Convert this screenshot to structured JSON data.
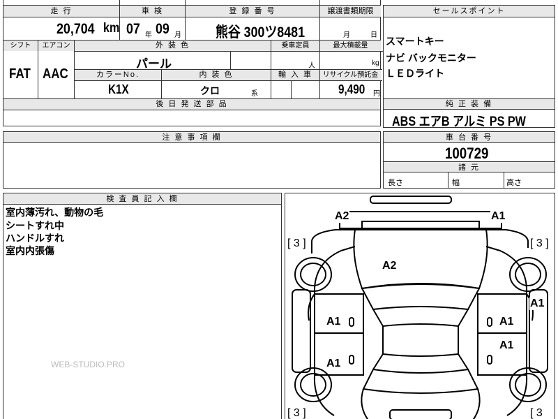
{
  "top_row": {
    "mileage_label": "走 行",
    "inspection_label": "車 検",
    "registration_label": "登 録 番 号",
    "transfer_label": "譲渡書類期限",
    "mileage_value": "20,704",
    "mileage_unit": "km",
    "inspection_year": "07",
    "year_unit": "年",
    "inspection_month": "09",
    "month_unit": "月",
    "registration_value": "熊谷 300ツ8481",
    "transfer_month_unit": "月",
    "transfer_day_unit": "日"
  },
  "spec_row": {
    "shift_label": "シフト",
    "ac_label": "エアコン",
    "exterior_label": "外 装 色",
    "capacity_label": "乗車定員",
    "load_label": "最大積載量",
    "shift_value": "FAT",
    "ac_value": "AAC",
    "exterior_value": "パール",
    "capacity_unit": "人",
    "load_unit": "kg",
    "color_no_label": "カラーNo.",
    "interior_label": "内 装 色",
    "import_label": "輸 入 車",
    "recycle_label": "リサイクル預託金",
    "color_no_value": "K1X",
    "interior_value": "クロ",
    "interior_suffix": "系",
    "recycle_value": "9,490",
    "recycle_unit": "円",
    "later_parts_label": "後 日 発 送 部 品"
  },
  "sales_points": {
    "label": "セールスポイント",
    "items": [
      "スマートキー",
      "ナビ バックモニター",
      "ＬＥＤライト"
    ]
  },
  "equipment": {
    "label": "純 正 装 備",
    "value": "ABS エアB アルミ PS PW"
  },
  "notes": {
    "label": "注 意 事 項 欄"
  },
  "chassis": {
    "label": "車 台 番 号",
    "value": "100729",
    "spec_label": "諸 元",
    "length_label": "長さ",
    "width_label": "幅",
    "height_label": "高さ"
  },
  "inspector": {
    "label": "検 査 員 記 入 欄",
    "lines": [
      "室内薄汚れ、動物の毛",
      "シートすれ中",
      "ハンドルすれ",
      "室内内張傷"
    ]
  },
  "watermark": "WEB-STUDIO.PRO",
  "damage_marks": {
    "front_left_bumper": "A2",
    "front_right_bumper": "A1",
    "hood": "A2",
    "right_fender": "A1",
    "left_front_door": "A1",
    "right_front_door": "A1",
    "right_rear_door": "A1",
    "left_rear_door": "A1",
    "left_front_wheel": "[ 3 ]",
    "right_front_wheel": "[ 3 ]",
    "left_rear_wheel": "[ 3 ]",
    "right_rear_wheel": "[ 3"
  }
}
